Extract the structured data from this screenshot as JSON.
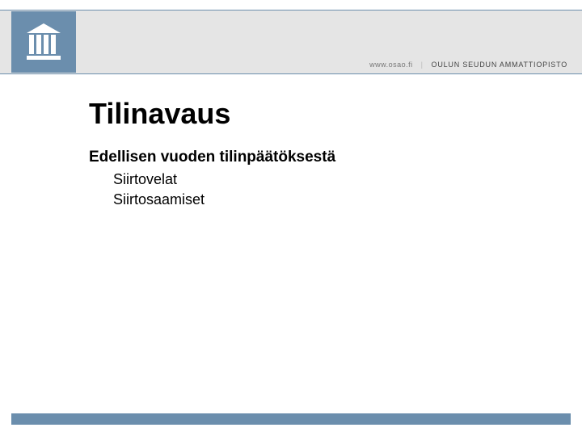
{
  "header": {
    "url": "www.osao.fi",
    "org": "OULUN SEUDUN AMMATTIOPISTO"
  },
  "content": {
    "title": "Tilinavaus",
    "subtitle": "Edellisen vuoden tilinpäätöksestä",
    "items": [
      "Siirtovelat",
      "Siirtosaamiset"
    ]
  }
}
